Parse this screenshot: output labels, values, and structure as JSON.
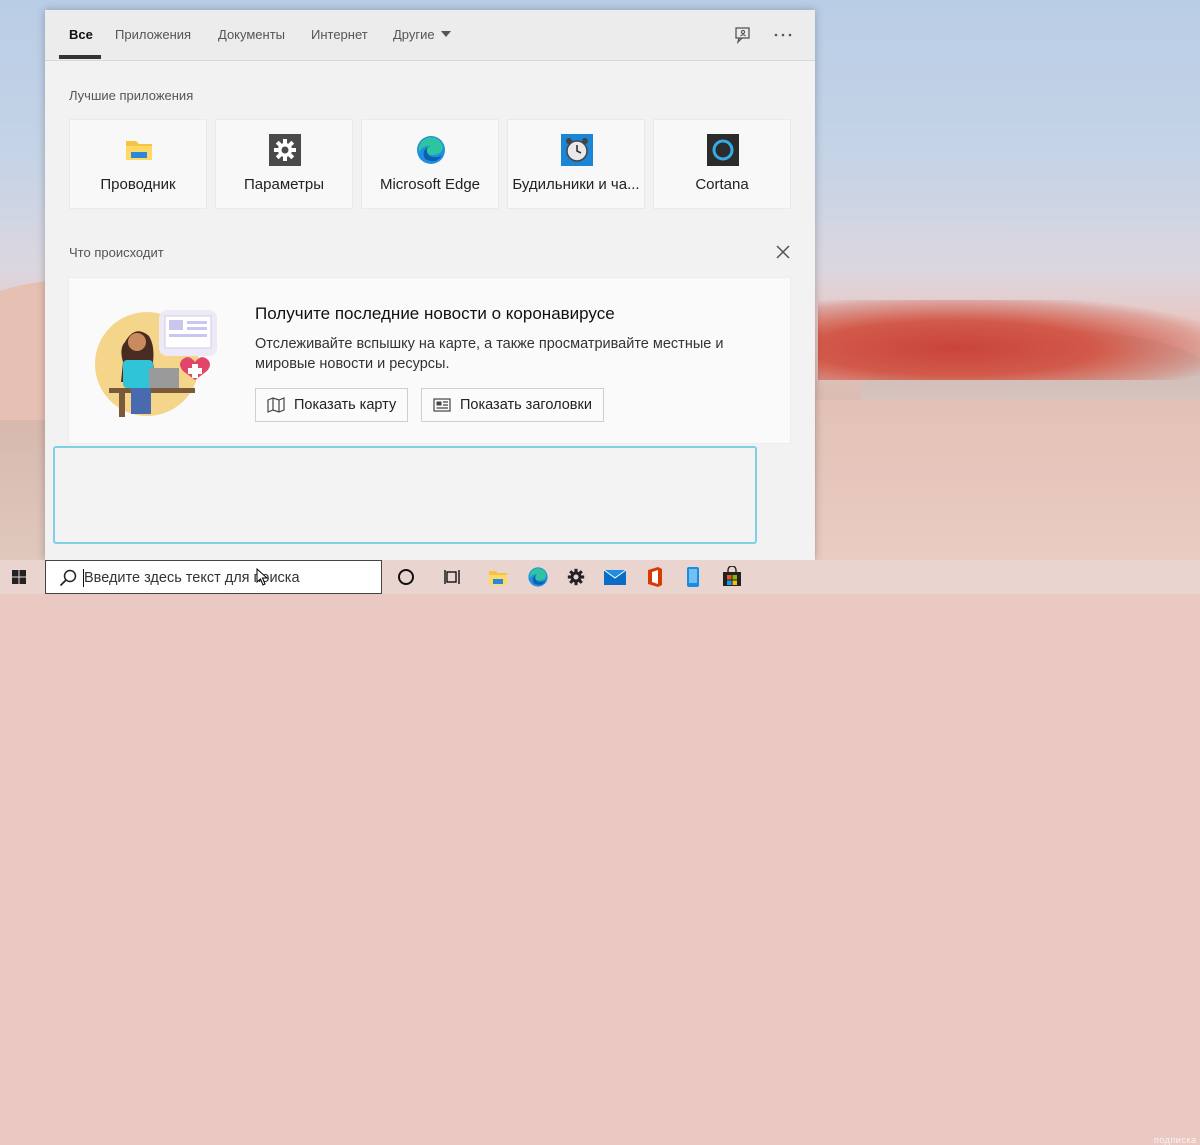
{
  "tabs": [
    {
      "label": "Все",
      "active": true
    },
    {
      "label": "Приложения"
    },
    {
      "label": "Документы"
    },
    {
      "label": "Интернет"
    },
    {
      "label": "Другие"
    }
  ],
  "best_apps": {
    "heading": "Лучшие приложения",
    "items": [
      {
        "label": "Проводник",
        "icon": "file-explorer-icon"
      },
      {
        "label": "Параметры",
        "icon": "settings-gear-icon"
      },
      {
        "label": "Microsoft Edge",
        "icon": "edge-icon"
      },
      {
        "label": "Будильники и ча...",
        "icon": "alarm-clock-icon"
      },
      {
        "label": "Cortana",
        "icon": "cortana-icon"
      }
    ]
  },
  "whats_happening": {
    "heading": "Что происходит",
    "card": {
      "title": "Получите последние новости о коронавирусе",
      "description": "Отслеживайте вспышку на карте, а также просматривайте местные и мировые новости и ресурсы.",
      "buttons": [
        {
          "label": "Показать карту",
          "icon": "map-icon"
        },
        {
          "label": "Показать заголовки",
          "icon": "news-icon"
        }
      ]
    }
  },
  "taskbar": {
    "search_placeholder": "Введите здесь текст для поиска",
    "pinned_icons": [
      "cortana-circle-icon",
      "task-view-icon",
      "file-explorer-icon",
      "edge-icon",
      "settings-icon",
      "mail-icon",
      "office-icon",
      "phone-icon",
      "store-icon"
    ]
  },
  "watermark": "подписка",
  "colors": {
    "accent": "#0078d7",
    "focus_border": "#7fd0e4"
  }
}
